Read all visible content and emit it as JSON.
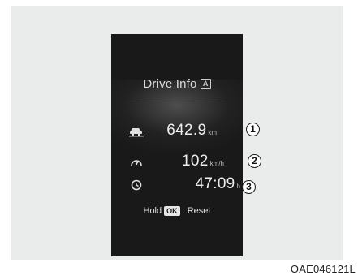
{
  "screen": {
    "title": "Drive Info",
    "title_badge": "A",
    "rows": [
      {
        "icon": "fuel-economy-icon",
        "value": "642.9",
        "unit": "km",
        "callout": "1"
      },
      {
        "icon": "speedometer-icon",
        "value": "102",
        "unit": "km/h",
        "callout": "2"
      },
      {
        "icon": "clock-icon",
        "value": "47:09",
        "unit": "h",
        "callout": "3"
      }
    ],
    "hold_label": "Hold",
    "ok_label": "OK",
    "reset_label": ": Reset"
  },
  "caption": "OAE046121L",
  "colors": {
    "panel_background": "#eaebeb",
    "display_background": "#191919",
    "text": "#ededed"
  }
}
